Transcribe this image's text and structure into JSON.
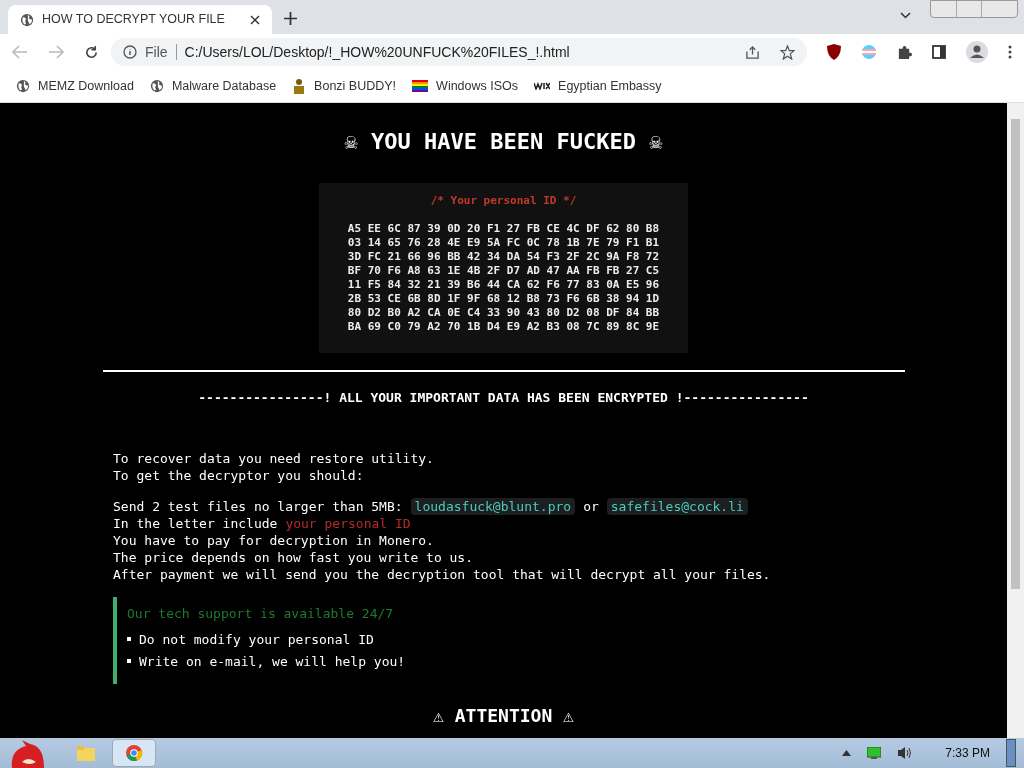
{
  "tab": {
    "title": "HOW TO DECRYPT YOUR FILE",
    "selected": true
  },
  "address": {
    "scheme": "File",
    "url": "C:/Users/LOL/Desktop/!_HOW%20UNFUCK%20FILES_!.html"
  },
  "bookmarks": [
    {
      "kind": "globe",
      "label": "MEMZ Download"
    },
    {
      "kind": "globe",
      "label": "Malware Database"
    },
    {
      "kind": "figure",
      "label": "Bonzi BUDDY!"
    },
    {
      "kind": "rainbow",
      "label": "Windows ISOs"
    },
    {
      "kind": "wix",
      "label": "Egyptian Embassy"
    }
  ],
  "page": {
    "heading": "☠ YOU HAVE BEEN FUCKED ☠",
    "id_box": {
      "title": "/* Your personal ID */",
      "rows": [
        "A5 EE 6C 87 39 0D 20 F1 27 FB CE 4C DF 62 80 B8",
        "03 14 65 76 28 4E E9 5A FC 0C 78 1B 7E 79 F1 B1",
        "3D FC 21 66 96 BB 42 34 DA 54 F3 2F 2C 9A F8 72",
        "BF 70 F6 A8 63 1E 4B 2F D7 AD 47 AA FB FB 27 C5",
        "11 F5 84 32 21 39 B6 44 CA 62 F6 77 83 0A E5 96",
        "2B 53 CE 6B 8D 1F 9F 68 12 B8 73 F6 6B 38 94 1D",
        "80 D2 B0 A2 CA 0E C4 33 90 43 80 D2 08 DF 84 BB",
        "BA 69 C0 79 A2 70 1B D4 E9 A2 B3 08 7C 89 8C 9E"
      ]
    },
    "banner": "----------------! ALL YOUR IMPORTANT DATA HAS BEEN ENCRYPTED !----------------",
    "intro": [
      "To recover data you need restore utility.",
      "To get the decryptor you should:"
    ],
    "send": {
      "text": "Send 2 test files no larger than 5MB:",
      "email_1": "loudasfuck@blunt.pro",
      "or": "or",
      "email_2": "safefiles@cock.li"
    },
    "include": {
      "text": "In the letter include",
      "highlight": "your personal ID"
    },
    "lines": [
      "You have to pay for decryption in Monero.",
      "The price depends on how fast you write to us.",
      "After payment we will send you the decryption tool that will decrypt all your files."
    ],
    "support": {
      "title": "Our tech support is available 24/7",
      "items": [
        "Do not modify your personal ID",
        "Write on e-mail, we will help you!"
      ]
    },
    "attention": "⚠ ATTENTION ⚠"
  },
  "taskbar": {
    "time": "7:33 PM"
  }
}
